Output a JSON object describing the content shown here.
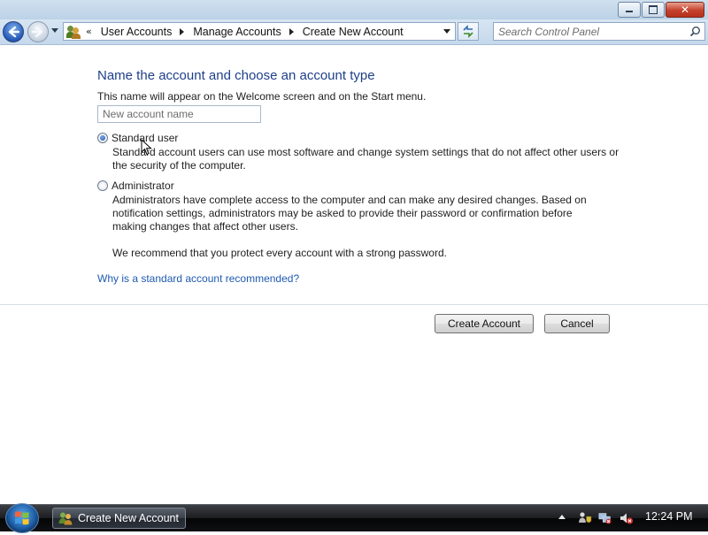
{
  "window": {
    "buttons": {
      "minimize": "minimize",
      "maximize": "maximize",
      "close": "close"
    }
  },
  "navigation": {
    "breadcrumb": [
      "User Accounts",
      "Manage Accounts",
      "Create New Account"
    ],
    "overflow_glyph": "«",
    "search_placeholder": "Search Control Panel"
  },
  "form": {
    "heading": "Name the account and choose an account type",
    "subtext": "This name will appear on the Welcome screen and on the Start menu.",
    "name_placeholder": "New account name",
    "name_value": "",
    "selected_type": "standard",
    "options": [
      {
        "label": "Standard user",
        "desc_lines": [
          "Standard account users can use most software and change system settings that do not affect other users or",
          "the security of the computer."
        ]
      },
      {
        "label": "Administrator",
        "desc_lines": [
          "Administrators have complete access to the computer and can make any desired changes. Based on",
          "notification settings, administrators may be asked to provide their password or confirmation before",
          "making changes that affect other users."
        ]
      }
    ],
    "recommendation": "We recommend that you protect every account with a strong password.",
    "help_link": "Why is a standard account recommended?",
    "create_button": "Create Account",
    "cancel_button": "Cancel"
  },
  "taskbar": {
    "task_label": "Create New Account",
    "clock": "12:24 PM"
  },
  "colors": {
    "heading": "#1e3f8a",
    "link": "#1e5ab0",
    "taskbar": "#0f1012"
  }
}
